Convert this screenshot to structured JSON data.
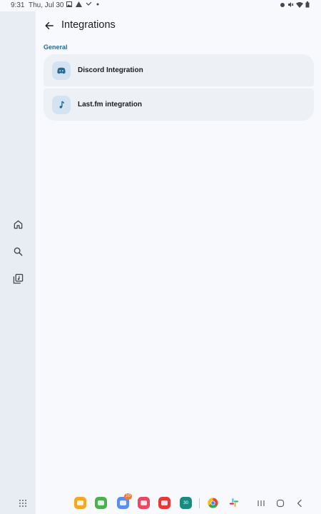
{
  "status_bar": {
    "time": "9:31",
    "date": "Thu, Jul 30",
    "notification_icons": [
      "image-icon",
      "warning-icon",
      "missed-call-icon",
      "dot-icon"
    ],
    "system_icons": [
      "alarm-icon",
      "mute-icon",
      "wifi-icon",
      "battery-icon"
    ]
  },
  "nav_rail": {
    "items": [
      {
        "name": "home",
        "icon": "home-icon"
      },
      {
        "name": "search",
        "icon": "search-icon"
      },
      {
        "name": "library",
        "icon": "library-icon"
      }
    ]
  },
  "header": {
    "title": "Integrations",
    "back_icon": "arrow-back-icon"
  },
  "section": {
    "label": "General",
    "items": [
      {
        "label": "Discord Integration",
        "icon": "discord-icon"
      },
      {
        "label": "Last.fm integration",
        "icon": "music-note-icon"
      }
    ]
  },
  "taskbar": {
    "apps": [
      {
        "name": "my-files",
        "color": "#f6a623"
      },
      {
        "name": "calculator",
        "color": "#4caf50"
      },
      {
        "name": "calendar",
        "color": "#5b8def",
        "badge": "10"
      },
      {
        "name": "screen-recorder",
        "color": "#e84861"
      },
      {
        "name": "flipboard",
        "color": "#e53935"
      },
      {
        "name": "calendar-30",
        "color": "#1a8b80",
        "text": "30"
      },
      {
        "name": "chrome",
        "color": "#4285f4"
      },
      {
        "name": "slack",
        "color": "#611f69"
      }
    ]
  },
  "colors": {
    "accent": "#2b6a8e",
    "rail_background": "#e8edf3",
    "row_background": "#edf1f6",
    "icon_tile": "#d3e3f1"
  }
}
